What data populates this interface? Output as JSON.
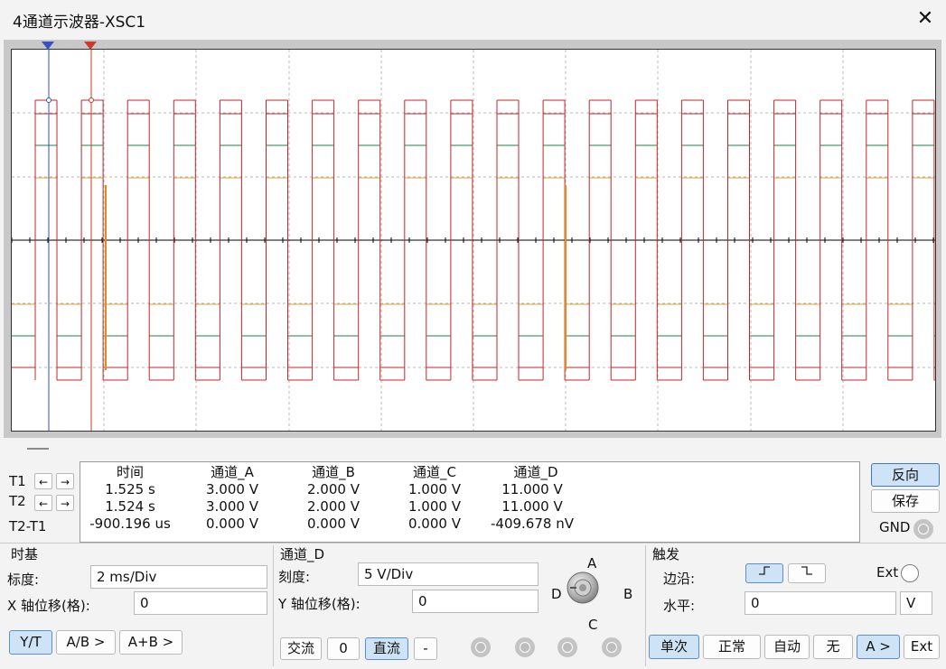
{
  "window": {
    "title": "4通道示波器-XSC1",
    "close_glyph": "✕"
  },
  "trace_colors": {
    "A": "#c3262a",
    "B": "#208040",
    "C": "#e2a33a",
    "D": "#e28a1c",
    "T1": "#3a4fc6",
    "T2": "#c83a2a"
  },
  "readout": {
    "headers": [
      "时间",
      "通道_A",
      "通道_B",
      "通道_C",
      "通道_D"
    ],
    "rows": [
      {
        "label": "T1",
        "values": [
          "1.525 s",
          "3.000 V",
          "2.000 V",
          "1.000 V",
          "11.000 V"
        ]
      },
      {
        "label": "T2",
        "values": [
          "1.524 s",
          "3.000 V",
          "2.000 V",
          "1.000 V",
          "11.000 V"
        ]
      },
      {
        "label": "T2-T1",
        "values": [
          "-900.196 us",
          "0.000 V",
          "0.000 V",
          "0.000 V",
          "-409.678 nV"
        ]
      }
    ]
  },
  "cursor_arrows": {
    "left": "←",
    "right": "→"
  },
  "side_buttons": {
    "reverse": "反向",
    "save": "保存",
    "gnd": "GND"
  },
  "timebase": {
    "title": "时基",
    "scale_label": "标度:",
    "scale_value": "2 ms/Div",
    "xoffset_label": "X 轴位移(格):",
    "xoffset_value": "0",
    "modes": [
      "Y/T",
      "A/B >",
      "A+B >"
    ],
    "active_mode": "Y/T"
  },
  "channel": {
    "title": "通道_D",
    "scale_label": "刻度:",
    "scale_value": "5  V/Div",
    "yoffset_label": "Y 轴位移(格):",
    "yoffset_value": "0",
    "ac_label": "交流",
    "zero_label": "0",
    "dc_label": "直流",
    "minus_label": "-",
    "knob_labels": {
      "A": "A",
      "B": "B",
      "C": "C",
      "D": "D"
    }
  },
  "trigger": {
    "title": "触发",
    "edge_label": "边沿:",
    "rise_glyph": "↯",
    "fall_glyph": "↯",
    "ext_label": "Ext",
    "level_label": "水平:",
    "level_value": "0",
    "level_unit": "V",
    "modes": [
      "单次",
      "正常",
      "自动",
      "无",
      "A >",
      "Ext"
    ],
    "active_modes": [
      "单次",
      "A >"
    ]
  }
}
